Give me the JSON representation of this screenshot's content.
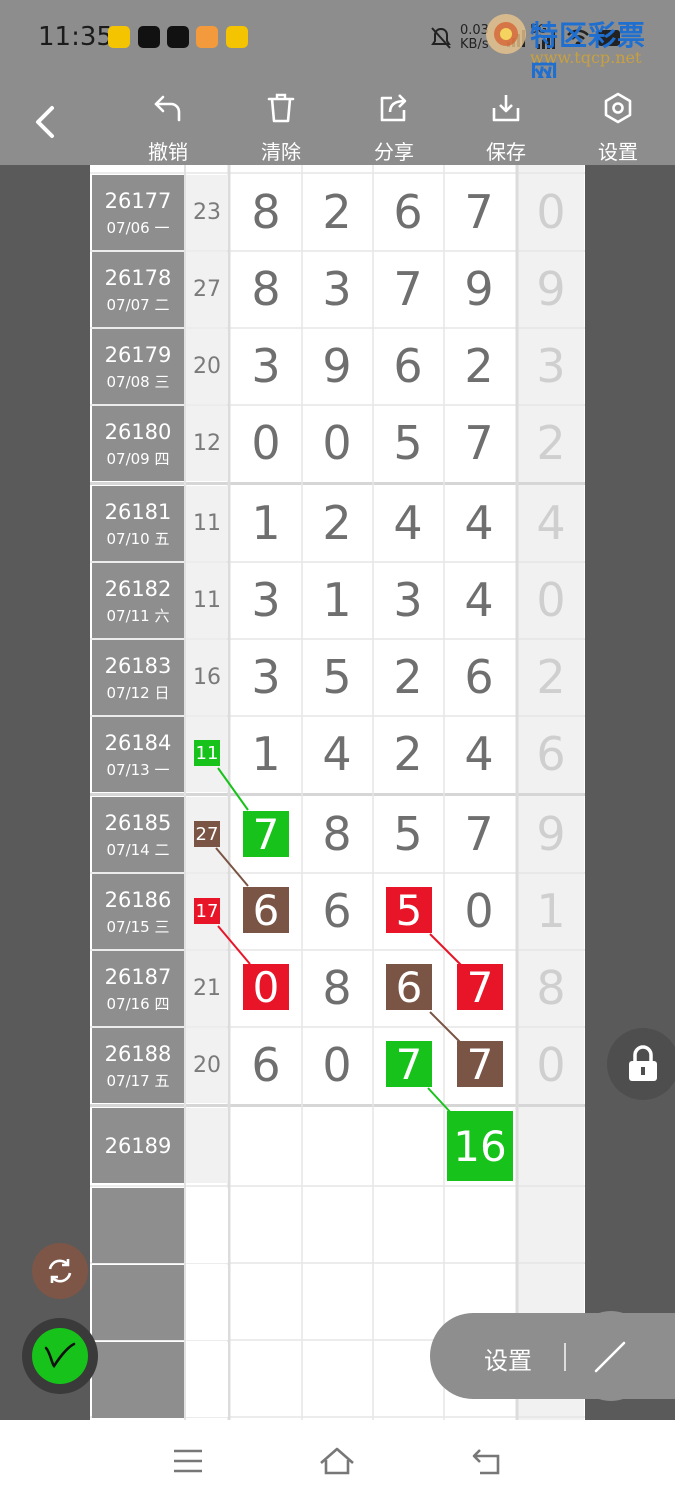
{
  "status": {
    "time": "11:35",
    "net_speed": "0.03",
    "net_unit": "KB/s",
    "signal": "5G"
  },
  "watermark": {
    "title": "特区彩票网",
    "url": "www.tqcp.net"
  },
  "toolbar": {
    "undo": "撤销",
    "clear": "清除",
    "share": "分享",
    "save": "保存",
    "settings": "设置"
  },
  "rows": [
    {
      "issue": "26177",
      "date": "07/06 一",
      "sum": "23",
      "d": [
        "8",
        "2",
        "6",
        "7"
      ],
      "last": "0"
    },
    {
      "issue": "26178",
      "date": "07/07 二",
      "sum": "27",
      "d": [
        "8",
        "3",
        "7",
        "9"
      ],
      "last": "9"
    },
    {
      "issue": "26179",
      "date": "07/08 三",
      "sum": "20",
      "d": [
        "3",
        "9",
        "6",
        "2"
      ],
      "last": "3"
    },
    {
      "issue": "26180",
      "date": "07/09 四",
      "sum": "12",
      "d": [
        "0",
        "0",
        "5",
        "7"
      ],
      "last": "2"
    },
    {
      "issue": "26181",
      "date": "07/10 五",
      "sum": "11",
      "d": [
        "1",
        "2",
        "4",
        "4"
      ],
      "last": "4"
    },
    {
      "issue": "26182",
      "date": "07/11 六",
      "sum": "11",
      "d": [
        "3",
        "1",
        "3",
        "4"
      ],
      "last": "0"
    },
    {
      "issue": "26183",
      "date": "07/12 日",
      "sum": "16",
      "d": [
        "3",
        "5",
        "2",
        "6"
      ],
      "last": "2"
    },
    {
      "issue": "26184",
      "date": "07/13 一",
      "sum": "11",
      "d": [
        "1",
        "4",
        "2",
        "4"
      ],
      "last": "6"
    },
    {
      "issue": "26185",
      "date": "07/14 二",
      "sum": "27",
      "d": [
        "7",
        "8",
        "5",
        "7"
      ],
      "last": "9"
    },
    {
      "issue": "26186",
      "date": "07/15 三",
      "sum": "17",
      "d": [
        "6",
        "6",
        "5",
        "0"
      ],
      "last": "1"
    },
    {
      "issue": "26187",
      "date": "07/16 四",
      "sum": "21",
      "d": [
        "0",
        "8",
        "6",
        "7"
      ],
      "last": "8"
    },
    {
      "issue": "26188",
      "date": "07/17 五",
      "sum": "20",
      "d": [
        "6",
        "0",
        "7",
        "7"
      ],
      "last": "0"
    },
    {
      "issue": "26189",
      "date": "",
      "sum": "",
      "d": [
        "",
        "",
        "",
        ""
      ],
      "last": ""
    }
  ],
  "next_value": "16",
  "pill": {
    "label": "设置"
  },
  "colors": {
    "green": "#17c21a",
    "brown": "#7a5444",
    "red": "#e81528"
  }
}
